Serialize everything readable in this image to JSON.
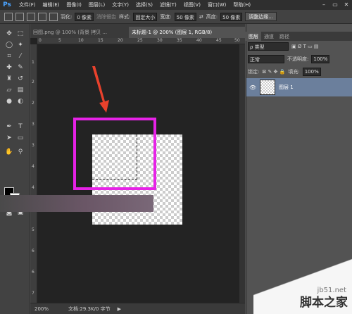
{
  "menubar": {
    "logo": "Ps",
    "items": [
      "文件(F)",
      "编辑(E)",
      "图像(I)",
      "图层(L)",
      "文字(Y)",
      "选择(S)",
      "滤镜(T)",
      "视图(V)",
      "窗口(W)",
      "帮助(H)"
    ],
    "window_buttons": [
      "–",
      "▭",
      "✕"
    ]
  },
  "options": {
    "feather_label": "羽化:",
    "feather_value": "0 像素",
    "antialias_label": "消除锯齿",
    "style_label": "样式:",
    "style_value": "固定大小",
    "width_label": "宽度:",
    "width_value": "50 像素",
    "height_label": "高度:",
    "height_value": "50 像素",
    "refine_button": "调整边缘..."
  },
  "tabs": [
    {
      "label": "回图.png @ 100% (背景 拷贝 ..."
    },
    {
      "label": "未标题-1 @ 200% (图层 1, RGB/8)"
    }
  ],
  "document": {
    "title": "未标题-1 @ 200% (图层 1, RGB/8)",
    "ruler_top": [
      "0",
      "5",
      "10",
      "15",
      "20",
      "25",
      "30",
      "35",
      "40",
      "45",
      "50"
    ],
    "ruler_left": [
      "1",
      "2",
      "2",
      "3",
      "3",
      "4",
      "4",
      "5",
      "5",
      "6",
      "6",
      "7"
    ]
  },
  "status": {
    "zoom": "200%",
    "doc_info": "文档:29.3K/0 字节"
  },
  "layers_panel": {
    "tabs": [
      "图层",
      "通道",
      "路径"
    ],
    "filter_label": "ρ 类型",
    "blend_mode": "正常",
    "opacity_label": "不透明度:",
    "opacity_value": "100%",
    "lock_label": "锁定:",
    "fill_label": "填充:",
    "fill_value": "100%",
    "layer_name": "图层 1"
  },
  "watermark": {
    "site": "jb51.net",
    "text": "脚本之家"
  },
  "colors": {
    "highlight": "#e622e6",
    "arrow": "#e8412c",
    "selected_layer": "#6b7f9c"
  }
}
